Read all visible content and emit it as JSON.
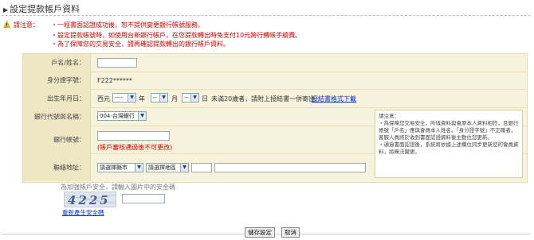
{
  "page": {
    "title": "設定提款帳戶資料"
  },
  "notice": {
    "label": "請注意：",
    "lines": [
      "・一經書面認證成功後，恕不提供變更銀行帳號服務。",
      "・設定提款帳號時，如使用台新銀行帳戶，在您提款轉出時免支付10元跨行轉帳手續費。",
      "・為了保障您的交易安全，請再確認提款轉出的銀行帳戶資料。"
    ]
  },
  "form": {
    "name_label": "戶名/姓名：",
    "name_value": "",
    "id_label": "身分證字號：",
    "id_value": "F222******",
    "birth_label": "出生年月日：",
    "birth_era": "西元",
    "birth_year_value": "----",
    "birth_year_unit": "年",
    "birth_month_value": "--",
    "birth_month_unit": "月",
    "birth_day_value": "--",
    "birth_day_unit": "日",
    "minor_note": "未滿20歲者，請附上授結書一併寄出",
    "minor_link": "授結書格式下載",
    "bank_label": "銀行代號與名稱：",
    "bank_value": "004-台灣銀行",
    "account_label": "銀行帳號：",
    "account_value": "",
    "account_note": "(帳戶審核通過後不可更改)",
    "address_label": "聯絡地址：",
    "city_value": "請選擇縣市",
    "district_value": "請選擇地區",
    "zip_value": "",
    "street_value": ""
  },
  "side_note": {
    "title": "請注意：",
    "lines": [
      "・為保障您交易安全，所填資料與會原本人資料相符，且銀行帳號「戶名」應與會員本人姓名。「身分證字號」不正確者，客服人員將於收到書面認證資料後主動位您更新。",
      "・通過書面認證後，系統將依據上述欄位同步更新您的會員資料，將無法變更。"
    ]
  },
  "captcha": {
    "hint": "為加強帳戶安全，請輸入圖片中的安全碼",
    "code": "4225",
    "refresh_link": "重新產生安全碼",
    "input_value": ""
  },
  "buttons": {
    "save": "儲存設定",
    "cancel": "取消"
  },
  "colors": {
    "form_bg": "#f7f2dc",
    "label_bg": "#efe6c4",
    "notice_red": "#cc0000",
    "link_blue": "#0033cc"
  }
}
